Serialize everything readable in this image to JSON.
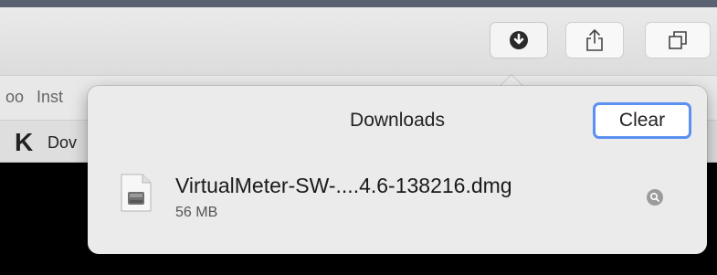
{
  "favorites": {
    "items": [
      "oo",
      "Inst"
    ]
  },
  "tab": {
    "label": "Dov"
  },
  "toolbar": {
    "buttons": [
      "downloads-icon",
      "share-icon",
      "tabs-overview-icon"
    ]
  },
  "downloads": {
    "title": "Downloads",
    "clear_label": "Clear",
    "items": [
      {
        "name": "VirtualMeter-SW-....4.6-138216.dmg",
        "size": "56 MB",
        "icon": "disk-image-icon"
      }
    ]
  },
  "colors": {
    "accent": "#5b8ff0",
    "content_bg": "#000000"
  }
}
